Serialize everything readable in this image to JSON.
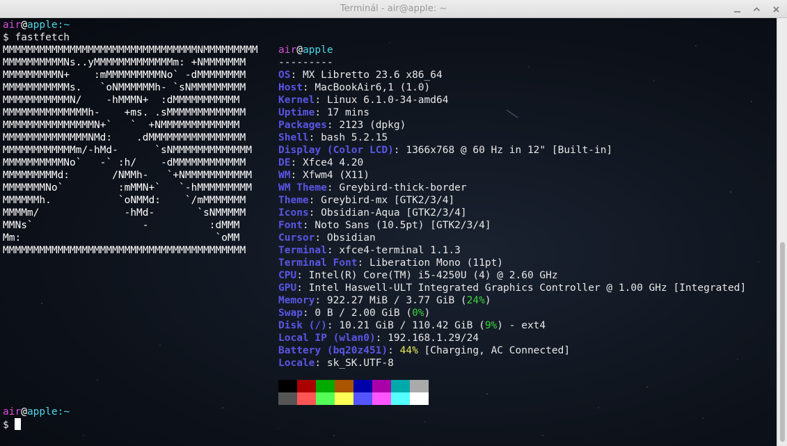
{
  "window": {
    "title": "Terminál - air@apple: ~"
  },
  "prompt1": {
    "user": "air",
    "at": "@",
    "host": "apple",
    "path": ":~",
    "dollar": "$",
    "command": " fastfetch"
  },
  "logo": [
    "MMMMMMMMMMMMMMMMMMMMMMMMMMMMMMMMNMMMMMMMMM",
    "MMMMMMMMMMNs..yMMMMMMMMMMMMMm: +NMMMMMMM",
    "MMMMMMMMMN+    :mMMMMMMMMMNo` -dMMMMMMMM",
    "MMMMMMMMMMMs.   `oNMMMMMMh- `sNMMMMMMMMM",
    "MMMMMMMMMMMN/    -hMMMN+  :dMMMMMMMMMMM",
    "MMMMMMMMMMMMMMh-    +ms. .sMMMMMMMMMMMMM",
    "MMMMMMMMMMMMMMMN+`   `  +NMMMMMMMMMMMMM",
    "MMMMMMMMMMMMMMNMd:    .dMMMMMMMMMMMMMMMM",
    "MMMMMMMMMMMMm/-hMd-      `sNMMMMMMMMMMMMM",
    "MMMMMMMMMMNo`   -` :h/    -dMMMMMMMMMMMM",
    "MMMMMMMMMd:       /NMMh-   `+NMMMMMMMMMMM",
    "MMMMMMMNo`         :mMMN+`   `-hMMMMMMMMM",
    "MMMMMMh.           `oNMMd:    `/mMMMMMMM",
    "MMMMm/              -hMd-       `sNMMMMM",
    "MMNs`                  -          :dMMM",
    "Mm:                                `oMM",
    "MMMMMMMMMMMMMMMMMMMMMMMMMMMMMMMMMMMMMMMM"
  ],
  "header": {
    "user": "air",
    "at": "@",
    "host": "apple",
    "underline": "---------"
  },
  "info": [
    {
      "key": "OS",
      "sep": ": ",
      "parts": [
        {
          "t": "MX Libretto 23.6 x86_64",
          "c": "val"
        }
      ]
    },
    {
      "key": "Host",
      "sep": ": ",
      "parts": [
        {
          "t": "MacBookAir6,1 (1.0)",
          "c": "val"
        }
      ]
    },
    {
      "key": "Kernel",
      "sep": ": ",
      "parts": [
        {
          "t": "Linux 6.1.0-34-amd64",
          "c": "val"
        }
      ]
    },
    {
      "key": "Uptime",
      "sep": ": ",
      "parts": [
        {
          "t": "17 mins",
          "c": "val"
        }
      ]
    },
    {
      "key": "Packages",
      "sep": ": ",
      "parts": [
        {
          "t": "2123 (dpkg)",
          "c": "val"
        }
      ]
    },
    {
      "key": "Shell",
      "sep": ": ",
      "parts": [
        {
          "t": "bash 5.2.15",
          "c": "val"
        }
      ]
    },
    {
      "key": "Display (Color LCD)",
      "sep": ": ",
      "parts": [
        {
          "t": "1366x768 @ 60 Hz in 12\" [Built-in]",
          "c": "val"
        }
      ]
    },
    {
      "key": "DE",
      "sep": ": ",
      "parts": [
        {
          "t": "Xfce4 4.20",
          "c": "val"
        }
      ]
    },
    {
      "key": "WM",
      "sep": ": ",
      "parts": [
        {
          "t": "Xfwm4 (X11)",
          "c": "val"
        }
      ]
    },
    {
      "key": "WM Theme",
      "sep": ": ",
      "parts": [
        {
          "t": "Greybird-thick-border",
          "c": "val"
        }
      ]
    },
    {
      "key": "Theme",
      "sep": ": ",
      "parts": [
        {
          "t": "Greybird-mx [GTK2/3/4]",
          "c": "val"
        }
      ]
    },
    {
      "key": "Icons",
      "sep": ": ",
      "parts": [
        {
          "t": "Obsidian-Aqua [GTK2/3/4]",
          "c": "val"
        }
      ]
    },
    {
      "key": "Font",
      "sep": ": ",
      "parts": [
        {
          "t": "Noto Sans (10.5pt) [GTK2/3/4]",
          "c": "val"
        }
      ]
    },
    {
      "key": "Cursor",
      "sep": ": ",
      "parts": [
        {
          "t": "Obsidian",
          "c": "val"
        }
      ]
    },
    {
      "key": "Terminal",
      "sep": ": ",
      "parts": [
        {
          "t": "xfce4-terminal 1.1.3",
          "c": "val"
        }
      ]
    },
    {
      "key": "Terminal Font",
      "sep": ": ",
      "parts": [
        {
          "t": "Liberation Mono (11pt)",
          "c": "val"
        }
      ]
    },
    {
      "key": "CPU",
      "sep": ": ",
      "parts": [
        {
          "t": "Intel(R) Core(TM) i5-4250U (4) @ 2.60 GHz",
          "c": "val"
        }
      ]
    },
    {
      "key": "GPU",
      "sep": ": ",
      "parts": [
        {
          "t": "Intel Haswell-ULT Integrated Graphics Controller @ 1.00 GHz [Integrated]",
          "c": "val"
        }
      ]
    },
    {
      "key": "Memory",
      "sep": ": ",
      "parts": [
        {
          "t": "922.27 MiB / 3.77 GiB (",
          "c": "val"
        },
        {
          "t": "24%",
          "c": "pct-green"
        },
        {
          "t": ")",
          "c": "val"
        }
      ]
    },
    {
      "key": "Swap",
      "sep": ": ",
      "parts": [
        {
          "t": "0 B / 2.00 GiB (",
          "c": "val"
        },
        {
          "t": "0%",
          "c": "pct-green"
        },
        {
          "t": ")",
          "c": "val"
        }
      ]
    },
    {
      "key": "Disk (/)",
      "sep": ": ",
      "parts": [
        {
          "t": "10.21 GiB / 110.42 GiB (",
          "c": "val"
        },
        {
          "t": "9%",
          "c": "pct-green"
        },
        {
          "t": ") - ext4",
          "c": "val"
        }
      ]
    },
    {
      "key": "Local IP (wlan0)",
      "sep": ": ",
      "parts": [
        {
          "t": "192.168.1.29/24",
          "c": "val"
        }
      ]
    },
    {
      "key": "Battery (bq20z451)",
      "sep": ": ",
      "parts": [
        {
          "t": "44%",
          "c": "pct-yellow"
        },
        {
          "t": " [Charging, AC Connected]",
          "c": "val"
        }
      ]
    },
    {
      "key": "Locale",
      "sep": ": ",
      "parts": [
        {
          "t": "sk_SK.UTF-8",
          "c": "val"
        }
      ]
    }
  ],
  "palette": {
    "normal": [
      "#000000",
      "#aa0000",
      "#00aa00",
      "#aa5500",
      "#0000aa",
      "#aa00aa",
      "#00aaaa",
      "#aaaaaa"
    ],
    "bright": [
      "#555555",
      "#ff5555",
      "#55ff55",
      "#ffff55",
      "#5555ff",
      "#ff55ff",
      "#55ffff",
      "#ffffff"
    ]
  },
  "prompt2": {
    "user": "air",
    "at": "@",
    "host": "apple",
    "path": ":~",
    "dollar": "$"
  },
  "colors": {
    "user": "#d94fd9",
    "host": "#4dd7e6",
    "key": "#5a56e6",
    "green": "#3bd13b",
    "yellow": "#e8e85a"
  }
}
